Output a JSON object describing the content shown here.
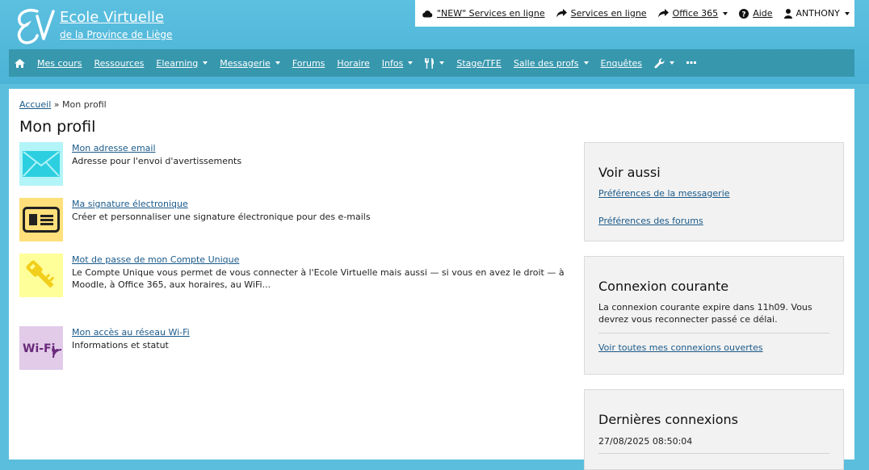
{
  "site": {
    "title": "Ecole Virtuelle",
    "subtitle": "de la Province de Liège"
  },
  "topbar": {
    "items": [
      {
        "label": "\"NEW\" Services en ligne",
        "icon": "cloud-icon"
      },
      {
        "label": "Services en ligne",
        "icon": "share-icon"
      },
      {
        "label": "Office 365",
        "icon": "share-icon",
        "dropdown": true
      },
      {
        "label": "Aide",
        "icon": "question-icon"
      },
      {
        "label": "ANTHONY",
        "icon": "user-icon",
        "dropdown": true
      }
    ]
  },
  "nav": {
    "items": [
      {
        "label": "Mes cours"
      },
      {
        "label": "Ressources"
      },
      {
        "label": "Elearning",
        "dropdown": true
      },
      {
        "label": "Messagerie",
        "dropdown": true
      },
      {
        "label": "Forums"
      },
      {
        "label": "Horaire"
      },
      {
        "label": "Infos",
        "dropdown": true
      },
      {
        "label": "Stage/TFE"
      },
      {
        "label": "Salle des profs",
        "dropdown": true
      },
      {
        "label": "Enquêtes"
      }
    ]
  },
  "breadcrumb": {
    "home": "Accueil",
    "separator": "»",
    "current": "Mon profil"
  },
  "page": {
    "title": "Mon profil"
  },
  "profile_items": [
    {
      "title": "Mon adresse email",
      "desc": "Adresse pour l'envoi d'avertissements",
      "icon": "envelope-icon",
      "color": "#b3f4f8"
    },
    {
      "title": "Ma signature électronique",
      "desc": "Créer et personnaliser une signature électronique pour des e-mails",
      "icon": "id-card-icon",
      "color": "#ffe07a"
    },
    {
      "title": "Mot de passe de mon Compte Unique",
      "desc": "Le Compte Unique vous permet de vous connecter à l'Ecole Virtuelle mais aussi — si vous en avez le droit — à Moodle, à Office 365, aux horaires, au WiFi...",
      "icon": "key-icon",
      "color": "#ffff99"
    },
    {
      "title": "Mon accès au réseau Wi-Fi",
      "desc": "Informations et statut",
      "icon": "wifi-icon",
      "color": "#e1cbe9",
      "icon_text": "Wi-Fi"
    }
  ],
  "see_also": {
    "title": "Voir aussi",
    "links": [
      "Préférences de la messagerie",
      "Préférences des forums"
    ]
  },
  "current_connection": {
    "title": "Connexion courante",
    "text": "La connexion courante expire dans 11h09. Vous devrez vous reconnecter passé ce délai.",
    "link": "Voir toutes mes connexions ouvertes"
  },
  "last_connections": {
    "title": "Dernières connexions",
    "items": [
      "27/08/2025 08:50:04"
    ]
  }
}
